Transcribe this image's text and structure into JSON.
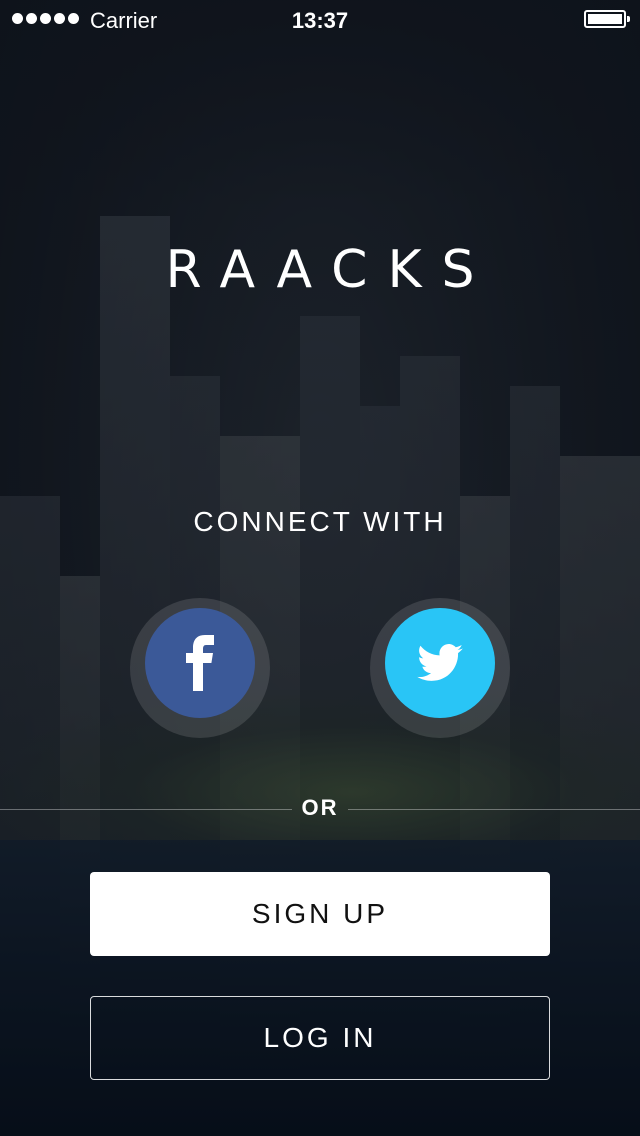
{
  "status_bar": {
    "carrier": "Carrier",
    "time": "13:37"
  },
  "app": {
    "logo": "RAACKS"
  },
  "connect": {
    "title": "CONNECT WITH",
    "facebook_icon": "facebook-icon",
    "twitter_icon": "twitter-icon",
    "facebook_color": "#3b5998",
    "twitter_color": "#29c5f6"
  },
  "divider": {
    "label": "OR"
  },
  "actions": {
    "signup_label": "SIGN UP",
    "login_label": "LOG IN"
  }
}
